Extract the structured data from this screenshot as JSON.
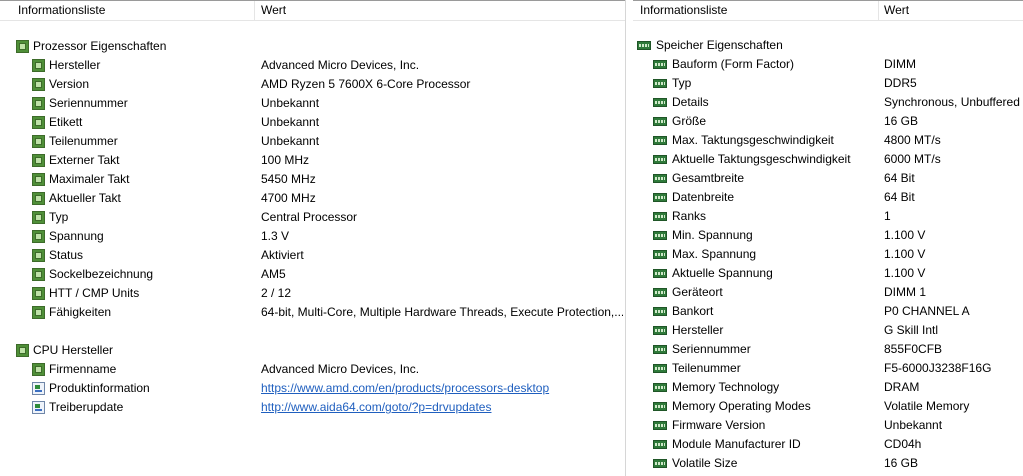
{
  "left": {
    "header": {
      "col1": "Informationsliste",
      "col2": "Wert"
    },
    "sections": [
      {
        "title": "Prozessor Eigenschaften",
        "icon": "cpu-chip-icon",
        "items": [
          {
            "label": "Hersteller",
            "value": "Advanced Micro Devices, Inc."
          },
          {
            "label": "Version",
            "value": "AMD Ryzen 5 7600X 6-Core Processor"
          },
          {
            "label": "Seriennummer",
            "value": "Unbekannt"
          },
          {
            "label": "Etikett",
            "value": "Unbekannt"
          },
          {
            "label": "Teilenummer",
            "value": "Unbekannt"
          },
          {
            "label": "Externer Takt",
            "value": "100 MHz"
          },
          {
            "label": "Maximaler Takt",
            "value": "5450 MHz"
          },
          {
            "label": "Aktueller Takt",
            "value": "4700 MHz"
          },
          {
            "label": "Typ",
            "value": "Central Processor"
          },
          {
            "label": "Spannung",
            "value": "1.3 V"
          },
          {
            "label": "Status",
            "value": "Aktiviert"
          },
          {
            "label": "Sockelbezeichnung",
            "value": "AM5"
          },
          {
            "label": "HTT / CMP Units",
            "value": "2 / 12"
          },
          {
            "label": "Fähigkeiten",
            "value": "64-bit, Multi-Core, Multiple Hardware Threads, Execute Protection,..."
          }
        ]
      },
      {
        "title": "CPU Hersteller",
        "icon": "cpu-chip-icon",
        "items": [
          {
            "label": "Firmenname",
            "value": "Advanced Micro Devices, Inc."
          },
          {
            "label": "Produktinformation",
            "value": "https://www.amd.com/en/products/processors-desktop",
            "link": true,
            "icon": "link-page-icon"
          },
          {
            "label": "Treiberupdate",
            "value": "http://www.aida64.com/goto/?p=drvupdates",
            "link": true,
            "icon": "link-page-icon"
          }
        ]
      }
    ]
  },
  "right": {
    "header": {
      "col1": "Informationsliste",
      "col2": "Wert"
    },
    "section": {
      "title": "Speicher Eigenschaften",
      "icon": "memory-module-icon",
      "items": [
        {
          "label": "Bauform (Form Factor)",
          "value": "DIMM"
        },
        {
          "label": "Typ",
          "value": "DDR5"
        },
        {
          "label": "Details",
          "value": "Synchronous, Unbuffered"
        },
        {
          "label": "Größe",
          "value": "16 GB"
        },
        {
          "label": "Max. Taktungsgeschwindigkeit",
          "value": "4800 MT/s"
        },
        {
          "label": "Aktuelle Taktungsgeschwindigkeit",
          "value": "6000 MT/s"
        },
        {
          "label": "Gesamtbreite",
          "value": "64 Bit"
        },
        {
          "label": "Datenbreite",
          "value": "64 Bit"
        },
        {
          "label": "Ranks",
          "value": "1"
        },
        {
          "label": "Min. Spannung",
          "value": "1.100 V"
        },
        {
          "label": "Max. Spannung",
          "value": "1.100 V"
        },
        {
          "label": "Aktuelle Spannung",
          "value": "1.100 V"
        },
        {
          "label": "Geräteort",
          "value": "DIMM 1"
        },
        {
          "label": "Bankort",
          "value": "P0 CHANNEL A"
        },
        {
          "label": "Hersteller",
          "value": "G Skill Intl"
        },
        {
          "label": "Seriennummer",
          "value": "855F0CFB"
        },
        {
          "label": "Teilenummer",
          "value": "F5-6000J3238F16G"
        },
        {
          "label": "Memory Technology",
          "value": "DRAM"
        },
        {
          "label": "Memory Operating Modes",
          "value": "Volatile Memory"
        },
        {
          "label": "Firmware Version",
          "value": "Unbekannt"
        },
        {
          "label": "Module Manufacturer ID",
          "value": "CD04h"
        },
        {
          "label": "Volatile Size",
          "value": "16 GB"
        }
      ]
    }
  },
  "colors": {
    "link": "#1f5fbf",
    "chip": "#4f8f38",
    "ram": "#2f7a3a"
  }
}
